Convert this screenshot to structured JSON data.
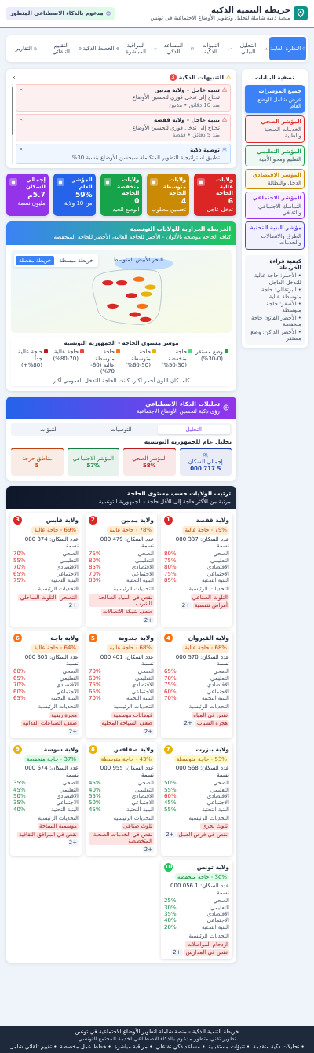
{
  "header": {
    "title": "خريطة التنمية الذكية",
    "subtitle": "منصة ذكية شاملة لتحليل وتطوير الأوضاع الاجتماعية في تونس",
    "badge": "مدعوم بالذكاء الاصطناعي المتطور"
  },
  "nav": [
    {
      "label": "النظرة العامة",
      "selected": true
    },
    {
      "label": "التحليل البياني",
      "selected": false
    },
    {
      "label": "التنبؤات الذكية",
      "selected": false
    },
    {
      "label": "المساعد الذكي",
      "selected": false
    },
    {
      "label": "المراقبة المباشرة",
      "selected": false
    },
    {
      "label": "الخطط الذكية",
      "selected": false
    },
    {
      "label": "التقييم التلقائي",
      "selected": false
    },
    {
      "label": "التقارير",
      "selected": false
    }
  ],
  "sidebar": {
    "title": "تصفية البيانات",
    "filters": [
      {
        "title": "جميع المؤشرات",
        "subtitle": "عرض شامل للوضع العام",
        "color": "#3b82f6",
        "selected": true
      },
      {
        "title": "المؤشر الصحي",
        "subtitle": "الخدمات الصحية والطبية",
        "color": "#dc2626",
        "selected": false
      },
      {
        "title": "المؤشر التعليمي",
        "subtitle": "التعليم ومحو الأمية",
        "color": "#16a34a",
        "selected": false
      },
      {
        "title": "المؤشر الاقتصادي",
        "subtitle": "الدخل والبطالة",
        "color": "#ca8a04",
        "selected": false
      },
      {
        "title": "المؤشر الاجتماعي",
        "subtitle": "التماسك الاجتماعي والثقافي",
        "color": "#9333ea",
        "selected": false
      },
      {
        "title": "مؤشر البنية التحتية",
        "subtitle": "الطرق والاتصالات والخدمات",
        "color": "#4f46e5",
        "selected": false
      }
    ],
    "guide": {
      "title": "كيفية قراءة الخريطة",
      "items": [
        "• الأحمر: حاجة عالية للتدخل العاجل",
        "• البرتقالي: حاجة متوسطة عالية",
        "• الأصفر: حاجة متوسطة",
        "• الأخضر الفاتح: حاجة منخفضة",
        "• الأخضر الداكن: وضع مستقر"
      ]
    }
  },
  "alerts": {
    "title": "التنبيهات الذكية",
    "count": "3",
    "items": [
      {
        "kind": "urgent",
        "title": "تنبيه عاجل - ولاية مدنين",
        "text": "تحتاج إلى تدخل فوري لتحسين الأوضاع",
        "meta": "منذ 10 دقائق • مدنين"
      },
      {
        "kind": "urgent",
        "title": "تنبيه عاجل - ولاية قفصة",
        "text": "تحتاج إلى تدخل فوري لتحسين الأوضاع",
        "meta": "منذ 5 دقائق • قفصة"
      },
      {
        "kind": "recommendation",
        "title": "توصية ذكية",
        "text": "تطبيق استراتيجية التطوير المتكاملة سيحسن الأوضاع بنسبة 30%"
      }
    ]
  },
  "stats": [
    {
      "label": "ولايات عالية الحاجة",
      "value": "6",
      "note": "تدخل عاجل",
      "color": "#dc2626"
    },
    {
      "label": "ولايات متوسطة الحاجة",
      "value": "4",
      "note": "تحسين مطلوب",
      "color": "#ca8a04"
    },
    {
      "label": "ولايات منخفضة الحاجة",
      "value": "0",
      "note": "الوضع الجيد",
      "color": "#16a34a"
    },
    {
      "label": "المؤشر العام",
      "value": "59%",
      "note": "من 10 ولاية",
      "color": "#2563eb"
    },
    {
      "label": "إجمالي السكان",
      "value": "5.7م",
      "note": "مليون نسمة",
      "color": "#9333ea"
    }
  ],
  "map": {
    "title": "الخريطة الحرارية للولايات التونسية",
    "subtitle": "كثافة الحاجة موضحة بالألوان - الأحمر للحاجة العالية، الأخضر للحاجة المنخفضة",
    "toggles": [
      {
        "label": "خريطة مبسطة",
        "selected": false
      },
      {
        "label": "خريطة مفصلة",
        "selected": true
      }
    ],
    "sea_label": "البحر الأبيض المتوسط",
    "markers": [
      {
        "color": "#dc2626"
      },
      {
        "color": "#dc2626"
      },
      {
        "color": "#f97316"
      },
      {
        "color": "#eab308"
      },
      {
        "color": "#dc2626"
      },
      {
        "color": "#eab308"
      },
      {
        "color": "#dc2626"
      },
      {
        "color": "#f97316"
      },
      {
        "color": "#dc2626"
      },
      {
        "color": "#dc2626"
      }
    ],
    "legend": {
      "title": "مؤشر مستوى الحاجة - الجمهورية التونسية",
      "items": [
        {
          "label": "وضع مستقر (0-30%)",
          "color": "#16a34a"
        },
        {
          "label": "حاجة منخفضة (30-50%)",
          "color": "#4ade80"
        },
        {
          "label": "حاجة متوسطة (50-60%)",
          "color": "#eab308"
        },
        {
          "label": "حاجة متوسطة عالية (60-70%)",
          "color": "#f97316"
        },
        {
          "label": "حاجة عالية (70-80%)",
          "color": "#ef4444"
        },
        {
          "label": "حاجة عالية جداً (80%+)",
          "color": "#b91c1c"
        }
      ],
      "note": "كلما كان اللون أحمر أكثر، كانت الحاجة للتدخل العمومي أكبر"
    }
  },
  "ai": {
    "title": "تحليلات الذكاء الاصطناعي",
    "subtitle": "رؤى ذكية لتحسين الأوضاع الاجتماعية",
    "tabs": [
      {
        "label": "التحليل",
        "selected": true
      },
      {
        "label": "التوصيات",
        "selected": false
      },
      {
        "label": "التنبؤات",
        "selected": false
      }
    ],
    "heading": "تحليل عام للجمهورية التونسية",
    "tiles": [
      {
        "kind": "people",
        "label": "إجمالي السكان",
        "value": "5 717 000",
        "color": "#1e40af"
      },
      {
        "kind": "plain",
        "label": "المؤشر الصحي",
        "value": "58%",
        "color": "#b91c1c"
      },
      {
        "kind": "plain",
        "label": "المؤشر الاجتماعي",
        "value": "57%",
        "color": "#15803d"
      },
      {
        "kind": "plain",
        "label": "مناطق حرجة",
        "value": "5",
        "color": "#c2410c"
      }
    ]
  },
  "ranking": {
    "title": "ترتيب الولايات حسب مستوى الحاجة",
    "subtitle": "مرتبة من الأكثر حاجة إلى الأقل حاجة - الجمهورية التونسية",
    "cards": [
      {
        "rank": "1",
        "color": "#dc2626",
        "name": "ولاية قفصة",
        "kind": "high",
        "challenges_label": "التحديات الرئيسية",
        "pill": "79% - حاجة عالية",
        "population": "عدد السكان: 337 000 نسمة",
        "metrics": [
          {
            "label": "الصحي",
            "value": "80%",
            "alert": true
          },
          {
            "label": "التعليمي",
            "value": "75%",
            "alert": true
          },
          {
            "label": "الاقتصادي",
            "value": "80%",
            "alert": true
          },
          {
            "label": "الاجتماعي",
            "value": "75%",
            "alert": true
          },
          {
            "label": "البنية التحتية",
            "value": "85%",
            "alert": true
          }
        ],
        "challenges": [
          "التلوث الصناعي",
          "أمراض تنفسية"
        ],
        "more": "+2"
      },
      {
        "rank": "2",
        "color": "#dc2626",
        "name": "ولاية مدنين",
        "kind": "high",
        "challenges_label": "التحديات الرئيسية",
        "pill": "78% - حاجة عالية",
        "population": "عدد السكان: 479 000 نسمة",
        "metrics": [
          {
            "label": "الصحي",
            "value": "75%",
            "alert": true
          },
          {
            "label": "التعليمي",
            "value": "80%",
            "alert": true
          },
          {
            "label": "الاقتصادي",
            "value": "85%",
            "alert": true
          },
          {
            "label": "الاجتماعي",
            "value": "70%",
            "alert": true
          },
          {
            "label": "البنية التحتية",
            "value": "80%",
            "alert": true
          }
        ],
        "challenges": [
          "نقص في المياه الصالحة للشرب",
          "ضعف شبكة الاتصالات"
        ],
        "more": "+2"
      },
      {
        "rank": "3",
        "color": "#dc2626",
        "name": "ولاية قابس",
        "kind": "high",
        "challenges_label": "التحديات الرئيسية",
        "pill": "69% - حاجة عالية",
        "population": "عدد السكان: 374 000 نسمة",
        "metrics": [
          {
            "label": "الصحي",
            "value": "70%",
            "alert": true
          },
          {
            "label": "التعليمي",
            "value": "55%",
            "alert": true
          },
          {
            "label": "الاقتصادي",
            "value": "70%",
            "alert": true
          },
          {
            "label": "الاجتماعي",
            "value": "65%",
            "alert": true
          },
          {
            "label": "البنية التحتية",
            "value": "75%",
            "alert": true
          }
        ],
        "challenges": [
          "التصحر",
          "التلوث الساحلي"
        ],
        "more": "+2"
      },
      {
        "rank": "4",
        "color": "#f97316",
        "name": "ولاية القيروان",
        "kind": "high",
        "challenges_label": "التحديات الرئيسية",
        "pill": "68% - حاجة عالية",
        "population": "عدد السكان: 570 000 نسمة",
        "metrics": [
          {
            "label": "الصحي",
            "value": "65%",
            "alert": true
          },
          {
            "label": "التعليمي",
            "value": "70%",
            "alert": true
          },
          {
            "label": "الاقتصادي",
            "value": "75%",
            "alert": true
          },
          {
            "label": "الاجتماعي",
            "value": "60%",
            "alert": true
          },
          {
            "label": "البنية التحتية",
            "value": "70%",
            "alert": true
          }
        ],
        "challenges": [
          "نقص في المياه",
          "هجرة الشباب"
        ],
        "more": "+2"
      },
      {
        "rank": "5",
        "color": "#f97316",
        "name": "ولاية جندوبة",
        "kind": "high",
        "challenges_label": "التحديات الرئيسية",
        "pill": "68% - حاجة عالية",
        "population": "عدد السكان: 401 000 نسمة",
        "metrics": [
          {
            "label": "الصحي",
            "value": "70%",
            "alert": true
          },
          {
            "label": "التعليمي",
            "value": "60%",
            "alert": true
          },
          {
            "label": "الاقتصادي",
            "value": "75%",
            "alert": true
          },
          {
            "label": "الاجتماعي",
            "value": "65%",
            "alert": true
          },
          {
            "label": "البنية التحتية",
            "value": "70%",
            "alert": true
          }
        ],
        "challenges": [
          "فيضانات موسمية",
          "ضعف السياحة المحلية"
        ],
        "more": "+2"
      },
      {
        "rank": "6",
        "color": "#f97316",
        "name": "ولاية باجة",
        "kind": "high",
        "challenges_label": "التحديات الرئيسية",
        "pill": "64% - حاجة عالية",
        "population": "عدد السكان: 303 000 نسمة",
        "metrics": [
          {
            "label": "الصحي",
            "value": "60%",
            "alert": true
          },
          {
            "label": "التعليمي",
            "value": "65%",
            "alert": true
          },
          {
            "label": "الاقتصادي",
            "value": "70%",
            "alert": true
          },
          {
            "label": "الاجتماعي",
            "value": "60%",
            "alert": true
          },
          {
            "label": "البنية التحتية",
            "value": "65%",
            "alert": true
          }
        ],
        "challenges": [
          "هجرة ريفية",
          "ضعف الصناعات الغذائية"
        ],
        "more": "+2"
      },
      {
        "rank": "7",
        "color": "#eab308",
        "name": "ولاية بنزرت",
        "kind": "medium",
        "challenges_label": "التحديات الرئيسية",
        "pill": "53% - حاجة متوسطة",
        "population": "عدد السكان: 568 000 نسمة",
        "metrics": [
          {
            "label": "الصحي",
            "value": "50%",
            "alert": false
          },
          {
            "label": "التعليمي",
            "value": "55%",
            "alert": false
          },
          {
            "label": "الاقتصادي",
            "value": "60%",
            "alert": true
          },
          {
            "label": "الاجتماعي",
            "value": "45%",
            "alert": false
          },
          {
            "label": "البنية التحتية",
            "value": "55%",
            "alert": false
          }
        ],
        "challenges": [
          "تلوث بحري",
          "نقص في فرص العمل"
        ],
        "more": "+2"
      },
      {
        "rank": "8",
        "color": "#eab308",
        "name": "ولاية صفاقس",
        "kind": "medium",
        "challenges_label": "التحديات الرئيسية",
        "pill": "43% - حاجة متوسطة",
        "population": "عدد السكان: 955 000 نسمة",
        "metrics": [
          {
            "label": "الصحي",
            "value": "45%",
            "alert": false
          },
          {
            "label": "التعليمي",
            "value": "40%",
            "alert": false
          },
          {
            "label": "الاقتصادي",
            "value": "55%",
            "alert": false
          },
          {
            "label": "الاجتماعي",
            "value": "50%",
            "alert": false
          },
          {
            "label": "البنية التحتية",
            "value": "45%",
            "alert": false
          }
        ],
        "challenges": [
          "تلوث صناعي",
          "نقص في الخدمات الصحية المتخصصة"
        ],
        "more": "+2"
      },
      {
        "rank": "9",
        "color": "#eab308",
        "name": "ولاية سوسة",
        "kind": "low",
        "challenges_label": "التحديات الرئيسية",
        "pill": "37% - حاجة منخفضة",
        "population": "عدد السكان: 674 000 نسمة",
        "metrics": [
          {
            "label": "الصحي",
            "value": "35%",
            "alert": false
          },
          {
            "label": "التعليمي",
            "value": "45%",
            "alert": false
          },
          {
            "label": "الاقتصادي",
            "value": "50%",
            "alert": false
          },
          {
            "label": "الاجتماعي",
            "value": "35%",
            "alert": false
          },
          {
            "label": "البنية التحتية",
            "value": "40%",
            "alert": false
          }
        ],
        "challenges": [
          "موسمية السياحة",
          "نقص في المرافق الثقافية"
        ],
        "more": "+2"
      },
      {
        "rank": "10",
        "color": "#22c55e",
        "name": "ولاية تونس",
        "kind": "low",
        "challenges_label": "التحديات الرئيسية",
        "pill": "30% - حاجة منخفضة",
        "population": "عدد السكان: 1 056 000 نسمة",
        "metrics": [
          {
            "label": "الصحي",
            "value": "25%",
            "alert": false
          },
          {
            "label": "التعليمي",
            "value": "30%",
            "alert": false
          },
          {
            "label": "الاقتصادي",
            "value": "35%",
            "alert": false
          },
          {
            "label": "الاجتماعي",
            "value": "40%",
            "alert": false
          },
          {
            "label": "البنية التحتية",
            "value": "20%",
            "alert": false
          }
        ],
        "challenges": [
          "ازدحام المواصلات",
          "نقص في المدارس"
        ],
        "more": "+2"
      }
    ]
  },
  "footer": {
    "title": "خريطة التنمية الذكية - منصة شاملة لتطوير الأوضاع الاجتماعية في تونس",
    "subtitle": "تطوير تقني متطور مدعوم بالذكاء الاصطناعي لخدمة المجتمع التونسي",
    "links": [
      "• تحليلات ذكية متقدمة",
      "• تنبؤات مستقبلية",
      "• مساعد ذكي تفاعلي",
      "• مراقبة مباشرة",
      "• خطط عمل مخصصة",
      "• تقييم تلقائي شامل"
    ]
  }
}
